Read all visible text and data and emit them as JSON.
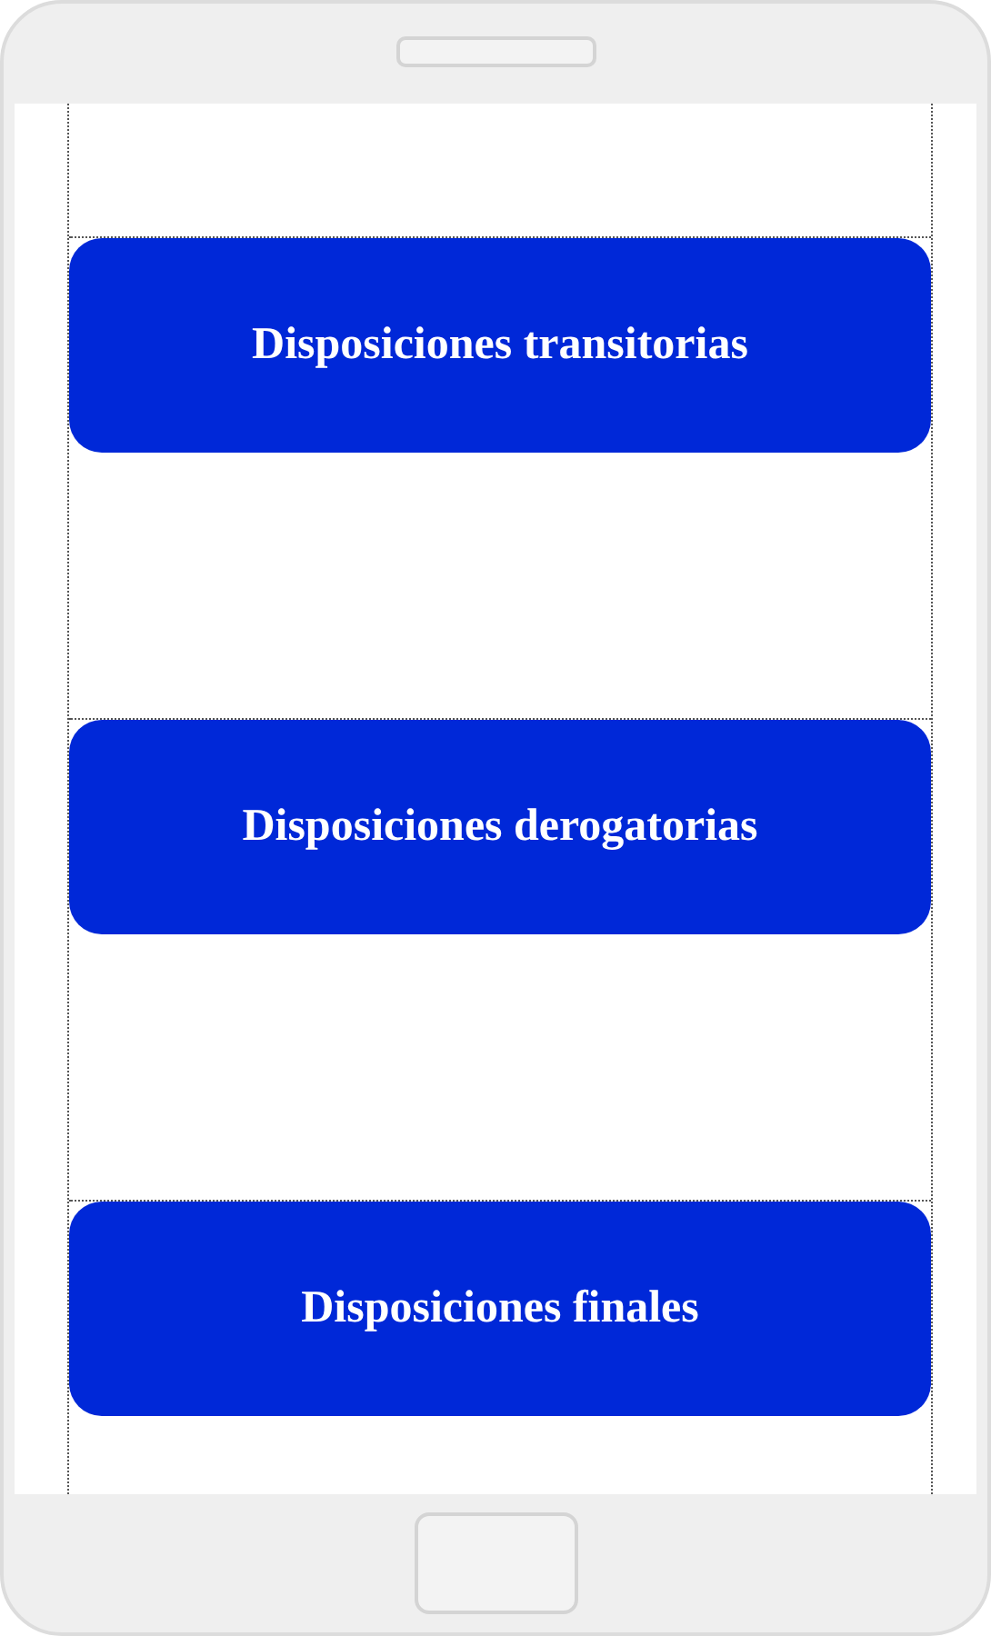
{
  "buttons": [
    {
      "label": "Disposiciones transitorias"
    },
    {
      "label": "Disposiciones derogatorias"
    },
    {
      "label": "Disposiciones finales"
    }
  ]
}
